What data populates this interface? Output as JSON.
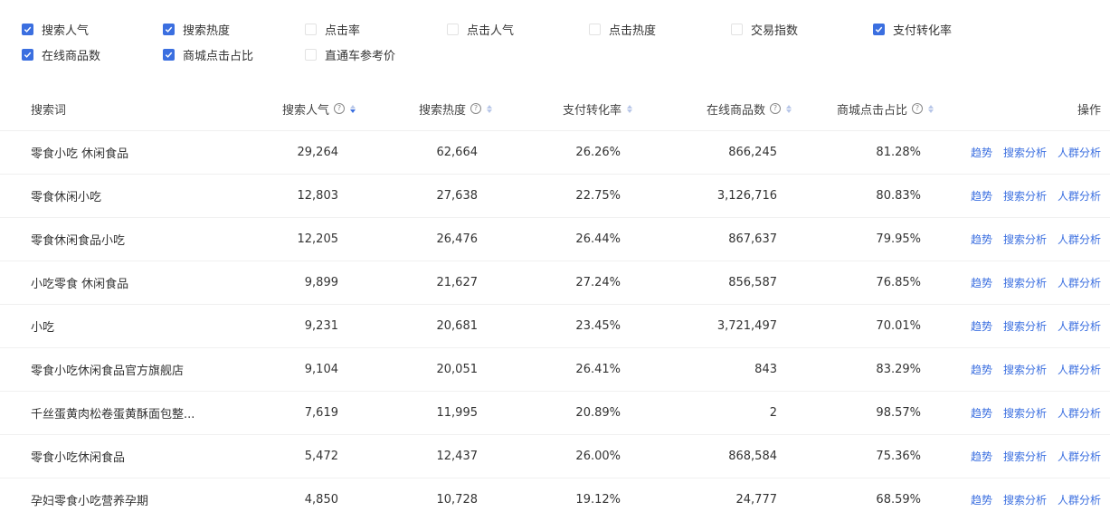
{
  "filters": [
    {
      "label": "搜索人气",
      "checked": true
    },
    {
      "label": "搜索热度",
      "checked": true
    },
    {
      "label": "点击率",
      "checked": false
    },
    {
      "label": "点击人气",
      "checked": false
    },
    {
      "label": "点击热度",
      "checked": false
    },
    {
      "label": "交易指数",
      "checked": false
    },
    {
      "label": "支付转化率",
      "checked": true
    },
    {
      "label": "在线商品数",
      "checked": true
    },
    {
      "label": "商城点击占比",
      "checked": true
    },
    {
      "label": "直通车参考价",
      "checked": false
    }
  ],
  "table": {
    "headers": {
      "keyword": "搜索词",
      "popularity": "搜索人气",
      "heat": "搜索热度",
      "conversion": "支付转化率",
      "products": "在线商品数",
      "mall_ratio": "商城点击占比",
      "actions": "操作"
    },
    "help_icon": "?",
    "sorted_by": "popularity",
    "action_labels": [
      "趋势",
      "搜索分析",
      "人群分析"
    ],
    "rows": [
      {
        "keyword": "零食小吃 休闲食品",
        "popularity": "29,264",
        "heat": "62,664",
        "conversion": "26.26%",
        "products": "866,245",
        "mall_ratio": "81.28%"
      },
      {
        "keyword": "零食休闲小吃",
        "popularity": "12,803",
        "heat": "27,638",
        "conversion": "22.75%",
        "products": "3,126,716",
        "mall_ratio": "80.83%"
      },
      {
        "keyword": "零食休闲食品小吃",
        "popularity": "12,205",
        "heat": "26,476",
        "conversion": "26.44%",
        "products": "867,637",
        "mall_ratio": "79.95%"
      },
      {
        "keyword": "小吃零食 休闲食品",
        "popularity": "9,899",
        "heat": "21,627",
        "conversion": "27.24%",
        "products": "856,587",
        "mall_ratio": "76.85%"
      },
      {
        "keyword": "小吃",
        "popularity": "9,231",
        "heat": "20,681",
        "conversion": "23.45%",
        "products": "3,721,497",
        "mall_ratio": "70.01%"
      },
      {
        "keyword": "零食小吃休闲食品官方旗舰店",
        "popularity": "9,104",
        "heat": "20,051",
        "conversion": "26.41%",
        "products": "843",
        "mall_ratio": "83.29%"
      },
      {
        "keyword": "千丝蛋黄肉松卷蛋黄酥面包整...",
        "popularity": "7,619",
        "heat": "11,995",
        "conversion": "20.89%",
        "products": "2",
        "mall_ratio": "98.57%"
      },
      {
        "keyword": "零食小吃休闲食品",
        "popularity": "5,472",
        "heat": "12,437",
        "conversion": "26.00%",
        "products": "868,584",
        "mall_ratio": "75.36%"
      },
      {
        "keyword": "孕妇零食小吃营养孕期",
        "popularity": "4,850",
        "heat": "10,728",
        "conversion": "19.12%",
        "products": "24,777",
        "mall_ratio": "68.59%"
      }
    ]
  },
  "colors": {
    "accent": "#3b6fe0",
    "text": "#333333",
    "muted": "#888888",
    "divider": "#f0f0f0"
  }
}
